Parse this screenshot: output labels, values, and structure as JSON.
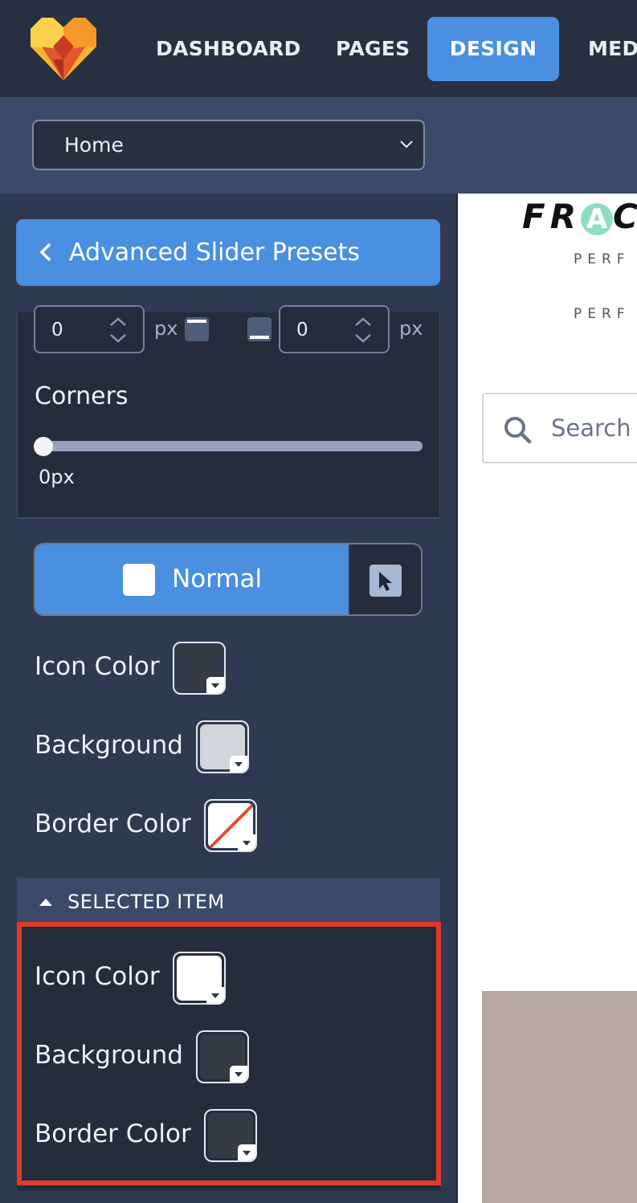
{
  "nav": {
    "items": [
      {
        "label": "DASHBOARD",
        "active": false
      },
      {
        "label": "PAGES",
        "active": false
      },
      {
        "label": "DESIGN",
        "active": true
      },
      {
        "label": "MEDI",
        "active": false
      }
    ],
    "accent": "#4a8fe0"
  },
  "page_select": {
    "value": "Home"
  },
  "panel": {
    "back_label": "Advanced Slider Presets",
    "border_inputs": [
      {
        "value": "0",
        "unit": "px"
      },
      {
        "value": "0",
        "unit": "px"
      }
    ],
    "corners": {
      "label": "Corners",
      "value": "0px",
      "fraction": 0
    },
    "state_toggle": {
      "normal_label": "Normal",
      "hover_icon": "cursor-icon"
    },
    "normal": {
      "icon_color": {
        "label": "Icon Color",
        "color": "#353b45"
      },
      "background": {
        "label": "Background",
        "color": "#d2d5d9"
      },
      "border_color": {
        "label": "Border Color",
        "color": "none"
      }
    },
    "selected_header": "SELECTED ITEM",
    "selected": {
      "icon_color": {
        "label": "Icon Color",
        "color": "#ffffff"
      },
      "background": {
        "label": "Background",
        "color": "#353b45"
      },
      "border_color": {
        "label": "Border Color",
        "color": "#353b45"
      }
    },
    "highlight_color": "#e03a2b"
  },
  "preview": {
    "brand_prefix": "FR",
    "brand_accent": "A",
    "brand_suffix": "C",
    "tagline_1": "PERF",
    "tagline_2": "PERF",
    "search_placeholder": "Search"
  }
}
